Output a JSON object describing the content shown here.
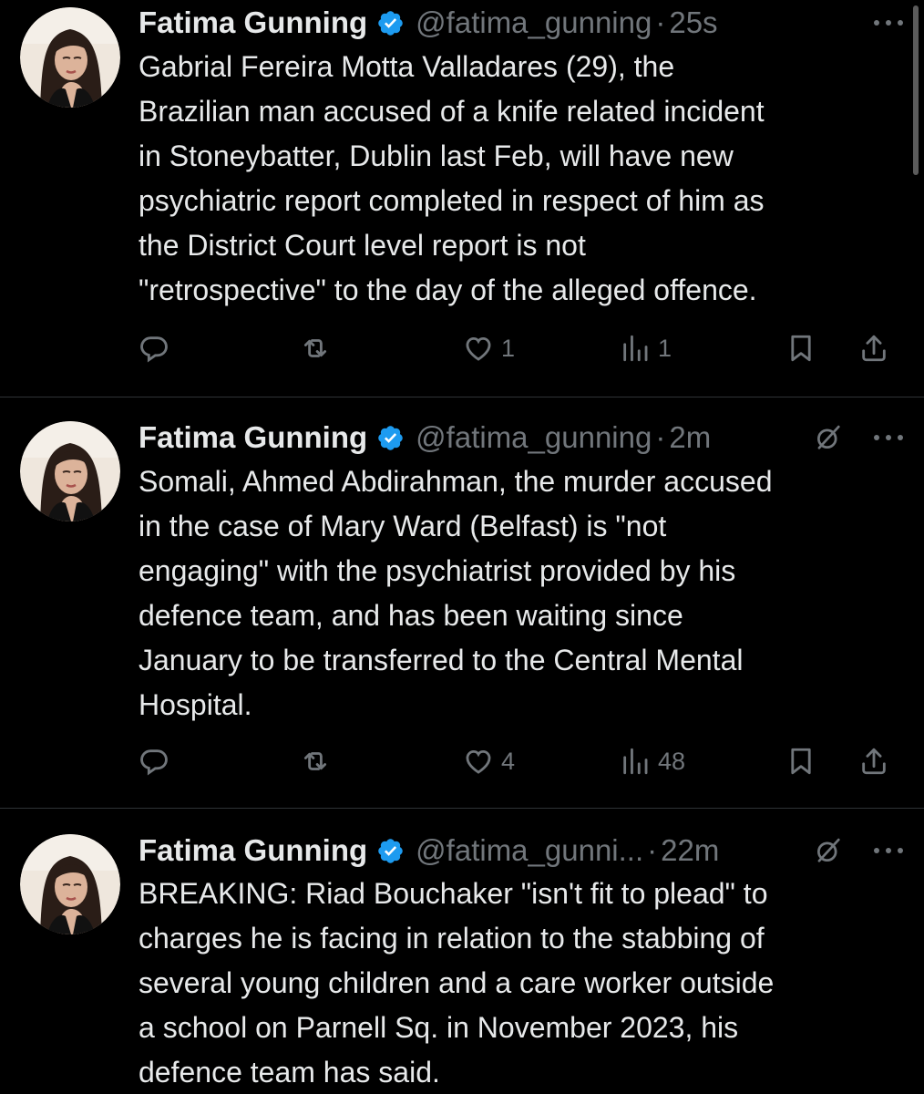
{
  "colors": {
    "background": "#000000",
    "text": "#e7e9ea",
    "secondary": "#71767b",
    "verified": "#1d9bf0",
    "divider": "#2f3336"
  },
  "tweets": [
    {
      "name": "Fatima Gunning",
      "handle": "@fatima_gunning",
      "separator": "·",
      "time": "25s",
      "text": "Gabrial Fereira Motta Valladares (29), the\nBrazilian man accused of a knife related incident\nin Stoneybatter, Dublin last Feb, will have new\npsychiatric report completed in respect of him as\nthe District Court level report is not\n\"retrospective\" to the day of the alleged offence.",
      "replies": "",
      "retweets": "",
      "likes": "1",
      "views": "1",
      "icons": [
        "verified-badge-icon",
        "more-icon",
        "reply-icon",
        "retweet-icon",
        "like-icon",
        "views-icon",
        "bookmark-icon",
        "share-icon"
      ]
    },
    {
      "name": "Fatima Gunning",
      "handle": "@fatima_gunning",
      "separator": "·",
      "time": "2m",
      "text": "Somali, Ahmed Abdirahman, the murder accused\nin the case of Mary Ward (Belfast) is \"not\nengaging\" with the psychiatrist provided by his\ndefence team, and has been waiting since\nJanuary to be transferred to the Central Mental\nHospital.",
      "replies": "",
      "retweets": "",
      "likes": "4",
      "views": "48",
      "icons": [
        "verified-badge-icon",
        "grok-icon",
        "more-icon",
        "reply-icon",
        "retweet-icon",
        "like-icon",
        "views-icon",
        "bookmark-icon",
        "share-icon"
      ]
    },
    {
      "name": "Fatima Gunning",
      "handle": "@fatima_gunni...",
      "separator": "·",
      "time": "22m",
      "text": "BREAKING: Riad Bouchaker \"isn't fit to plead\" to\ncharges he is facing in relation to the stabbing of\nseveral young children and a care worker outside\na school on Parnell Sq. in November 2023, his\ndefence team has said.",
      "icons": [
        "verified-badge-icon",
        "grok-icon",
        "more-icon"
      ]
    }
  ]
}
